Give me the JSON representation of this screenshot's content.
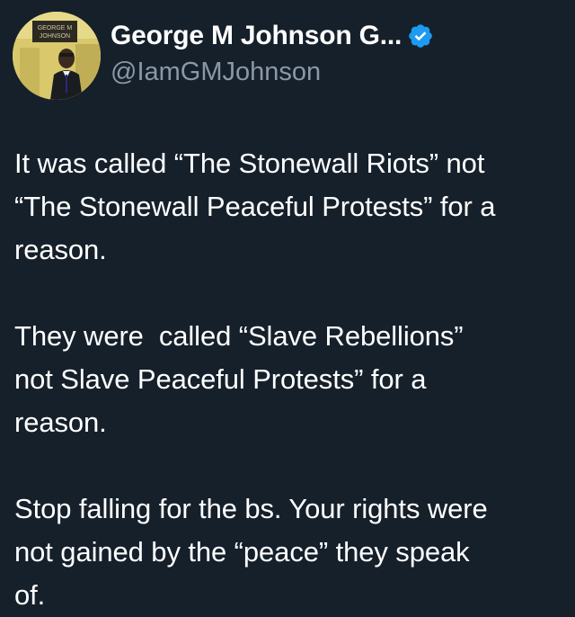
{
  "tweet": {
    "author": {
      "display_name": "George M Johnson G...",
      "handle": "@IamGMJohnson",
      "verified": true,
      "avatar_sign_text": "GEORGE M JOHNSON"
    },
    "paragraphs": [
      "It was called “The Stonewall Riots” not\n“The Stonewall Peaceful Protests” for a\nreason.",
      "They were  called “Slave Rebellions”\nnot Slave Peaceful Protests” for a\nreason.",
      "Stop falling for the bs. Your rights were\nnot gained by the “peace” they speak\nof."
    ]
  },
  "colors": {
    "background": "#15202b",
    "text": "#ffffff",
    "secondary_text": "#8b98a5",
    "verified_badge": "#1d9bf0"
  },
  "icons": {
    "verified": "verified-badge-icon"
  }
}
